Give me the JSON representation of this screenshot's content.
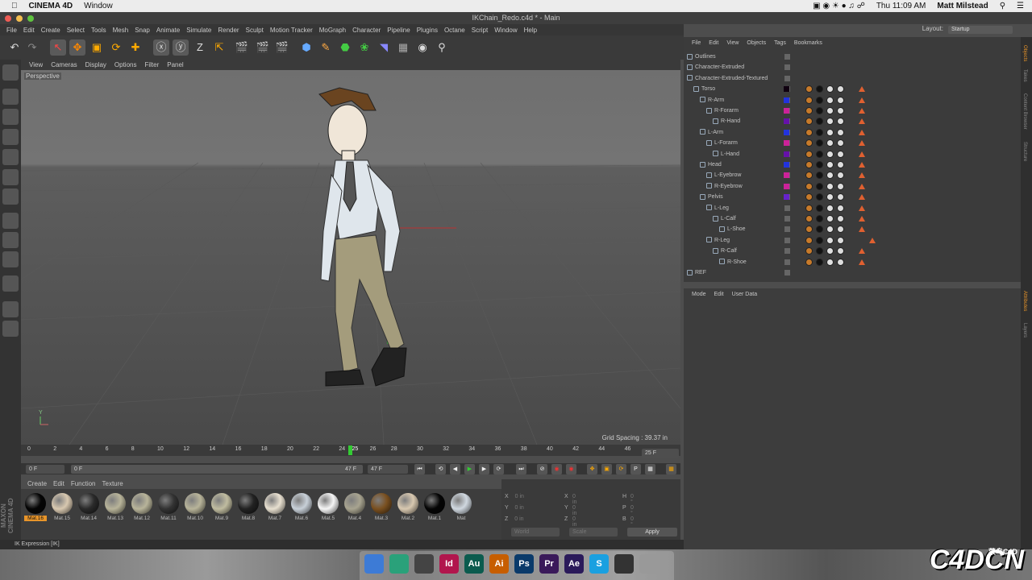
{
  "menubar": {
    "app_name": "CINEMA 4D",
    "window_menu": "Window",
    "clock": "Thu 11:09 AM",
    "user": "Matt Milstead"
  },
  "window": {
    "title": "IKChain_Redo.c4d * - Main"
  },
  "main_menu": [
    "File",
    "Edit",
    "Create",
    "Select",
    "Tools",
    "Mesh",
    "Snap",
    "Animate",
    "Simulate",
    "Render",
    "Sculpt",
    "Motion Tracker",
    "MoGraph",
    "Character",
    "Pipeline",
    "Plugins",
    "Octane",
    "Script",
    "Window",
    "Help"
  ],
  "layout": {
    "label": "Layout:",
    "value": "Startup"
  },
  "viewport": {
    "menu": [
      "View",
      "Cameras",
      "Display",
      "Options",
      "Filter",
      "Panel"
    ],
    "camera_label": "Perspective",
    "grid_spacing": "Grid Spacing : 39.37 in",
    "axis_y": "Y"
  },
  "timeline": {
    "ticks": [
      "0",
      "2",
      "4",
      "6",
      "8",
      "10",
      "12",
      "14",
      "16",
      "18",
      "20",
      "22",
      "24",
      "25",
      "26",
      "28",
      "30",
      "32",
      "34",
      "36",
      "38",
      "40",
      "42",
      "44",
      "46"
    ],
    "end_frame_label": "25 F"
  },
  "transport": {
    "start_field": "0 F",
    "min_field": "0 F",
    "max_field": "47 F",
    "end_field": "47 F"
  },
  "material_menu": [
    "Create",
    "Edit",
    "Function",
    "Texture"
  ],
  "materials": [
    {
      "name": "Mat.16",
      "color": "#050505"
    },
    {
      "name": "Mat.15",
      "color": "#d8c8b0"
    },
    {
      "name": "Mat.14",
      "color": "#2a2a2a"
    },
    {
      "name": "Mat.13",
      "color": "#b8b49a"
    },
    {
      "name": "Mat.12",
      "color": "#b8b49a"
    },
    {
      "name": "Mat.11",
      "color": "#333333"
    },
    {
      "name": "Mat.10",
      "color": "#b8b49a"
    },
    {
      "name": "Mat.9",
      "color": "#c0bca0"
    },
    {
      "name": "Mat.8",
      "color": "#222222"
    },
    {
      "name": "Mat.7",
      "color": "#e8e0d0"
    },
    {
      "name": "Mat.6",
      "color": "#c8d0d8"
    },
    {
      "name": "Mat.5",
      "color": "#f5f5f5"
    },
    {
      "name": "Mat.4",
      "color": "#a8a490"
    },
    {
      "name": "Mat.3",
      "color": "#7a5020"
    },
    {
      "name": "Mat.2",
      "color": "#d8c8b0"
    },
    {
      "name": "Mat.1",
      "color": "#050505"
    },
    {
      "name": "Mat",
      "color": "#d0d8e0"
    }
  ],
  "coords": {
    "rows": [
      [
        "X",
        "0 in",
        "X",
        "0 in",
        "H",
        "0 °"
      ],
      [
        "Y",
        "0 in",
        "Y",
        "0 in",
        "P",
        "0 °"
      ],
      [
        "Z",
        "0 in",
        "Z",
        "0 in",
        "B",
        "0 °"
      ]
    ],
    "mode_world": "World",
    "mode_scale": "Scale",
    "apply": "Apply"
  },
  "logo": "MAXON CINEMA 4D",
  "status": "IK Expression [IK]",
  "object_manager": {
    "menu": [
      "File",
      "Edit",
      "View",
      "Objects",
      "Tags",
      "Bookmarks"
    ],
    "objects": [
      {
        "name": "Outlines",
        "indent": 0,
        "color": "",
        "tags": false
      },
      {
        "name": "Character-Extruded",
        "indent": 0,
        "color": "",
        "tags": false
      },
      {
        "name": "Character-Extruded-Textured",
        "indent": 0,
        "color": "",
        "tags": false
      },
      {
        "name": "Torso",
        "indent": 1,
        "color": "#100010",
        "tags": true
      },
      {
        "name": "R-Arm",
        "indent": 2,
        "color": "#2233dd",
        "tags": true
      },
      {
        "name": "R-Forarm",
        "indent": 3,
        "color": "#cc2299",
        "tags": true
      },
      {
        "name": "R-Hand",
        "indent": 4,
        "color": "#6611aa",
        "tags": true
      },
      {
        "name": "L-Arm",
        "indent": 2,
        "color": "#2233dd",
        "tags": true
      },
      {
        "name": "L-Forarm",
        "indent": 3,
        "color": "#cc2299",
        "tags": true
      },
      {
        "name": "L-Hand",
        "indent": 4,
        "color": "#6611aa",
        "tags": true
      },
      {
        "name": "Head",
        "indent": 2,
        "color": "#2233dd",
        "tags": true
      },
      {
        "name": "L-Eyebrow",
        "indent": 3,
        "color": "#cc2299",
        "tags": true
      },
      {
        "name": "R-Eyebrow",
        "indent": 3,
        "color": "#cc2299",
        "tags": true
      },
      {
        "name": "Pelvis",
        "indent": 2,
        "color": "#6622cc",
        "tags": true
      },
      {
        "name": "L-Leg",
        "indent": 3,
        "color": "",
        "tags": true
      },
      {
        "name": "L-Calf",
        "indent": 4,
        "color": "",
        "tags": true
      },
      {
        "name": "L-Shoe",
        "indent": 5,
        "color": "",
        "tags": true
      },
      {
        "name": "R-Leg",
        "indent": 3,
        "color": "",
        "tags": true
      },
      {
        "name": "R-Calf",
        "indent": 4,
        "color": "",
        "tags": true
      },
      {
        "name": "R-Shoe",
        "indent": 5,
        "color": "",
        "tags": true
      },
      {
        "name": "REF",
        "indent": 0,
        "color": "",
        "tags": false
      }
    ]
  },
  "attribute_manager": {
    "menu": [
      "Mode",
      "Edit",
      "User Data"
    ]
  },
  "side_tabs": [
    "Objects",
    "Takes",
    "Content Browser",
    "Structure",
    "Attributes",
    "Layers"
  ],
  "dock": [
    {
      "label": "",
      "color": "#3d7bd6"
    },
    {
      "label": "",
      "color": "#2aa17a"
    },
    {
      "label": "",
      "color": "#444"
    },
    {
      "label": "Id",
      "color": "#b1164d"
    },
    {
      "label": "Au",
      "color": "#0b5b4e"
    },
    {
      "label": "Ai",
      "color": "#c75e00"
    },
    {
      "label": "Ps",
      "color": "#0a3a6a"
    },
    {
      "label": "Pr",
      "color": "#3a1a5a"
    },
    {
      "label": "Ae",
      "color": "#2a1a5a"
    },
    {
      "label": "S",
      "color": "#1aa0e0"
    },
    {
      "label": "",
      "color": "#333"
    },
    {
      "label": "",
      "color": "#999"
    }
  ],
  "watermark": {
    "main": "C4DCN",
    "sub": "菜鸟C4D"
  },
  "theme": {
    "accent": "#3c3",
    "ik_orange": "#e06030"
  }
}
